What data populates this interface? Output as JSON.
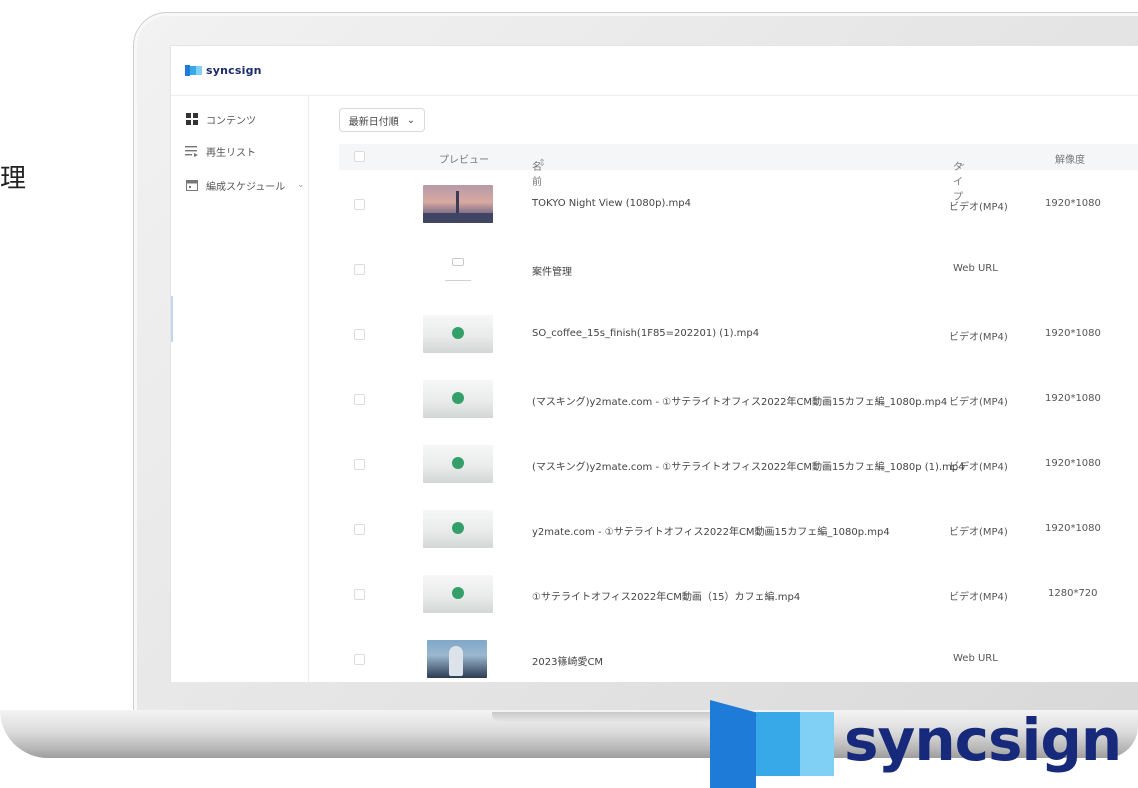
{
  "side_char": "理",
  "app": {
    "logo_text": "syncsign",
    "big_logo_text": "syncsign",
    "brand_colors": [
      "#1f7bd8",
      "#38a9e8",
      "#7fd0f4",
      "#17297a"
    ]
  },
  "sidebar": {
    "items": [
      {
        "label": "コンテンツ",
        "icon": "grid-icon"
      },
      {
        "label": "再生リスト",
        "icon": "playlist-icon"
      },
      {
        "label": "編成スケジュール",
        "icon": "calendar-icon",
        "chevron": "⌄"
      }
    ]
  },
  "toolbar": {
    "sort_label": "最新日付順",
    "sort_chevron": "⌄"
  },
  "table": {
    "headers": {
      "preview": "プレビュー",
      "name": "名前",
      "name_sort": "⇕",
      "type": "タイプ",
      "type_chevron": "⌄",
      "resolution": "解像度"
    },
    "rows": [
      {
        "name": "TOKYO Night View (1080p).mp4",
        "type": "ビデオ(MP4)",
        "resolution": "1920*1080",
        "thumb": "night"
      },
      {
        "name": "案件管理",
        "type": "Web URL",
        "resolution": "",
        "thumb": "web"
      },
      {
        "name": "SO_coffee_15s_finish(1F85=202201) (1).mp4",
        "type": "ビデオ(MP4)",
        "resolution": "1920*1080",
        "thumb": "coffee"
      },
      {
        "name": "(マスキング)y2mate.com - ①サテライトオフィス2022年CM動画15カフェ編_1080p.mp4",
        "type": "ビデオ(MP4)",
        "resolution": "1920*1080",
        "thumb": "coffee"
      },
      {
        "name": "(マスキング)y2mate.com - ①サテライトオフィス2022年CM動画15カフェ編_1080p (1).mp4",
        "type": "ビデオ(MP4)",
        "resolution": "1920*1080",
        "thumb": "coffee"
      },
      {
        "name": "y2mate.com - ①サテライトオフィス2022年CM動画15カフェ編_1080p.mp4",
        "type": "ビデオ(MP4)",
        "resolution": "1920*1080",
        "thumb": "coffee"
      },
      {
        "name": "①サテライトオフィス2022年CM動画（15）カフェ編.mp4",
        "type": "ビデオ(MP4)",
        "resolution": "1280*720",
        "thumb": "coffee"
      },
      {
        "name": "2023篠崎愛CM",
        "type": "Web URL",
        "resolution": "",
        "thumb": "photo"
      }
    ]
  }
}
